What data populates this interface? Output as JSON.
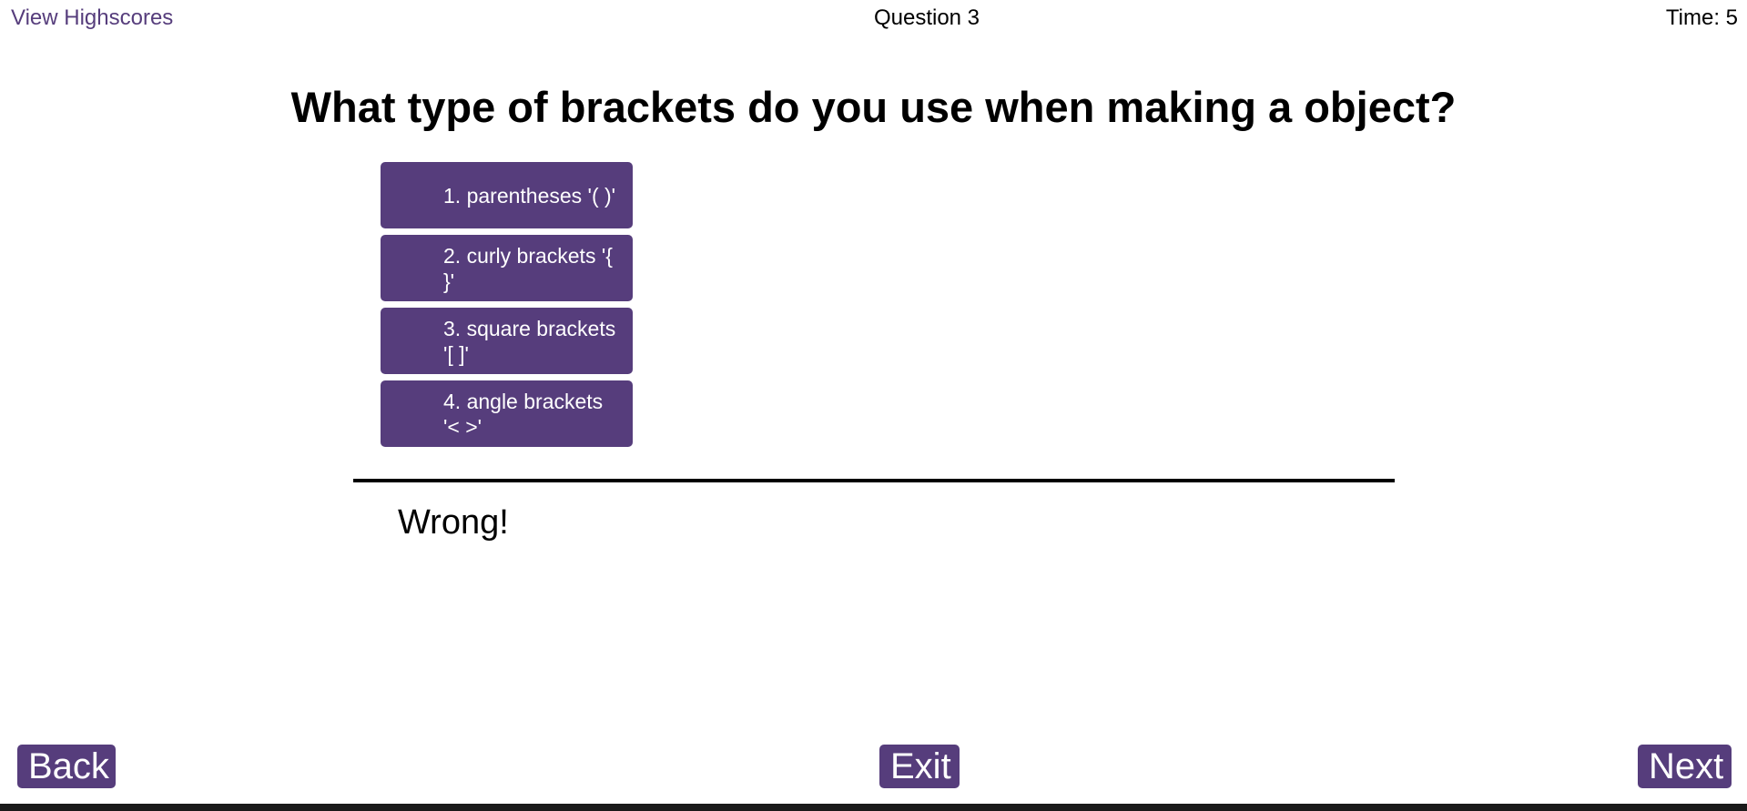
{
  "header": {
    "highscores_link": "View Highscores",
    "question_number": "Question 3",
    "timer": "Time: 5"
  },
  "question": {
    "text": "What type of brackets do you use when making a object?"
  },
  "answers": [
    "1. parentheses '( )'",
    "2. curly brackets '{ }'",
    "3. square brackets '[ ]'",
    "4. angle brackets '< >'"
  ],
  "feedback": "Wrong!",
  "navigation": {
    "back_label": "Back",
    "exit_label": "Exit",
    "next_label": "Next"
  },
  "colors": {
    "accent": "#563d7c",
    "text": "#000000",
    "background": "#ffffff"
  }
}
